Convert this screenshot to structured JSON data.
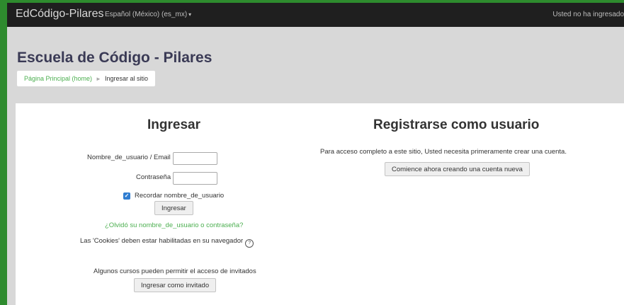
{
  "navbar": {
    "brand": "EdCódigo-Pilares",
    "language": "Español (México) (es_mx)",
    "language_caret": "▾",
    "login_info": "Usted no ha ingresado"
  },
  "header": {
    "site_title": "Escuela de Código - Pilares",
    "breadcrumb": {
      "home": "Página Principal (home)",
      "separator": "►",
      "current": "Ingresar al sitio"
    }
  },
  "login": {
    "title": "Ingresar",
    "username_label": "Nombre_de_usuario / Email",
    "username_value": "",
    "password_label": "Contraseña",
    "password_value": "",
    "remember_checked": true,
    "remember_label": "Recordar nombre_de_usuario",
    "submit_label": "Ingresar",
    "forgot_link": "¿Olvidó su nombre_de_usuario o contraseña?",
    "cookies_text": "Las 'Cookies' deben estar habilitadas en su navegador",
    "help_glyph": "?",
    "guest_text": "Algunos cursos pueden permitir el acceso de invitados",
    "guest_button": "Ingresar como invitado"
  },
  "signup": {
    "title": "Registrarse como usuario",
    "description": "Para acceso completo a este sitio, Usted necesita primeramente crear una cuenta.",
    "button": "Comience ahora creando una cuenta nueva"
  }
}
